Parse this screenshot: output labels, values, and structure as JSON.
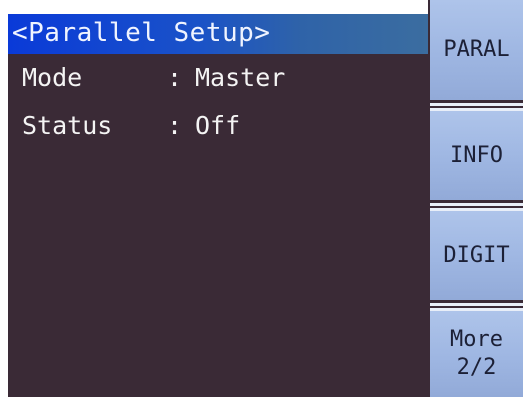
{
  "header": {
    "title": "<Parallel Setup>"
  },
  "parameters": [
    {
      "label": "Mode",
      "separator": ":",
      "value": "Master"
    },
    {
      "label": "Status",
      "separator": ":",
      "value": "Off"
    }
  ],
  "softkeys": [
    {
      "lines": [
        "PARAL"
      ]
    },
    {
      "lines": [
        "INFO"
      ]
    },
    {
      "lines": [
        "DIGIT"
      ]
    },
    {
      "lines": [
        "More",
        "2/2"
      ]
    }
  ],
  "colors": {
    "screen_background": "#3a2a36",
    "title_bar": "#0a3ad8",
    "softkey_background": "#9eb6e2",
    "softkey_text": "#1c2036",
    "text": "#f4f4f4"
  }
}
